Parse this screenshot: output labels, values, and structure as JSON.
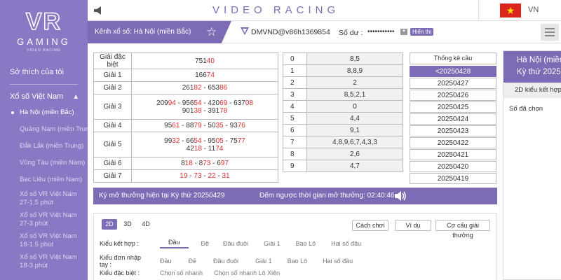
{
  "sidebar": {
    "logo_main": "VR",
    "logo_gaming": "GAMING",
    "logo_sub": "VIDEO RACING",
    "favorites": "Sở thích của tôi",
    "group": "Xổ số Việt Nam",
    "items": [
      {
        "label": "Hà Nội (miền Bắc)"
      },
      {
        "label": "Quảng Nam (miền Trung)"
      },
      {
        "label": "Đắk Lắk (miền Trung)"
      },
      {
        "label": "Vũng Tàu (miền Nam)"
      },
      {
        "label": "Bạc Liêu (miền Nam)"
      },
      {
        "label": "Xổ số VR Việt Nam 27-1.5 phút"
      },
      {
        "label": "Xổ số VR Việt Nam 27-3 phút"
      },
      {
        "label": "Xổ số VR Việt Nam 18-1.5 phút"
      },
      {
        "label": "Xổ số VR Việt Nam 18-3 phút"
      }
    ]
  },
  "header": {
    "title": "VIDEO RACING",
    "lang": "VN",
    "flag_star": "★"
  },
  "account": {
    "channel": "Kênh xổ số: Hà Nội (miền Bắc)",
    "username": "DMVND@v86h1369854",
    "balance_label": "Số dư :",
    "balance_mask": "•••••••••••",
    "show_label": "Hiển thị"
  },
  "results": [
    {
      "name": "Giải đặc biệt",
      "lines": [
        [
          [
            "751",
            ""
          ],
          [
            "40",
            "red"
          ]
        ]
      ]
    },
    {
      "name": "Giải 1",
      "lines": [
        [
          [
            "166",
            ""
          ],
          [
            "74",
            "red"
          ]
        ]
      ]
    },
    {
      "name": "Giải 2",
      "lines": [
        [
          [
            "261",
            ""
          ],
          [
            "82",
            "red"
          ],
          [
            " - 653",
            ""
          ],
          [
            "86",
            "red"
          ]
        ]
      ]
    },
    {
      "name": "Giải 3",
      "lines": [
        [
          [
            "209",
            ""
          ],
          [
            "94",
            "red"
          ],
          [
            " - 956",
            ""
          ],
          [
            "54",
            "red"
          ],
          [
            " - 420",
            ""
          ],
          [
            "69",
            "red"
          ],
          [
            " - 637",
            ""
          ],
          [
            "08",
            "red"
          ]
        ],
        [
          [
            "901",
            ""
          ],
          [
            "38",
            "red"
          ],
          [
            " - 391",
            ""
          ],
          [
            "78",
            "red"
          ]
        ]
      ]
    },
    {
      "name": "Giải 4",
      "lines": [
        [
          [
            "95",
            ""
          ],
          [
            "61",
            "red"
          ],
          [
            " - 88",
            ""
          ],
          [
            "79",
            "red"
          ],
          [
            " - 50",
            ""
          ],
          [
            "35",
            "red"
          ],
          [
            " - 93",
            ""
          ],
          [
            "76",
            "red"
          ]
        ]
      ]
    },
    {
      "name": "Giải 5",
      "lines": [
        [
          [
            "99",
            ""
          ],
          [
            "32",
            "red"
          ],
          [
            " - 66",
            ""
          ],
          [
            "54",
            "red"
          ],
          [
            " - 95",
            ""
          ],
          [
            "05",
            "red"
          ],
          [
            " - 75",
            ""
          ],
          [
            "77",
            "red"
          ]
        ],
        [
          [
            "42",
            ""
          ],
          [
            "18",
            "red"
          ],
          [
            " - 11",
            ""
          ],
          [
            "74",
            "red"
          ]
        ]
      ]
    },
    {
      "name": "Giải 6",
      "lines": [
        [
          [
            "8",
            ""
          ],
          [
            "18",
            "red"
          ],
          [
            " - 8",
            ""
          ],
          [
            "73",
            "red"
          ],
          [
            " - 6",
            ""
          ],
          [
            "97",
            "red"
          ]
        ]
      ]
    },
    {
      "name": "Giải 7",
      "lines": [
        [
          [
            "19",
            "red"
          ],
          [
            " - ",
            ""
          ],
          [
            "73",
            "red"
          ],
          [
            " - ",
            ""
          ],
          [
            "22",
            "red"
          ],
          [
            " - ",
            ""
          ],
          [
            "31",
            "red"
          ]
        ]
      ]
    }
  ],
  "lo": [
    {
      "n": "0",
      "v": "8,5"
    },
    {
      "n": "1",
      "v": "8,8,9"
    },
    {
      "n": "2",
      "v": "2"
    },
    {
      "n": "3",
      "v": "8,5,2,1"
    },
    {
      "n": "4",
      "v": "0"
    },
    {
      "n": "5",
      "v": "4,4"
    },
    {
      "n": "6",
      "v": "9,1"
    },
    {
      "n": "7",
      "v": "4,8,9,6,7,4,3,3"
    },
    {
      "n": "8",
      "v": "2,6"
    },
    {
      "n": "9",
      "v": "4,7"
    }
  ],
  "stats": {
    "header": "Thống kê cầu",
    "items": [
      "<20250428",
      "20250427",
      "20250426",
      "20250425",
      "20250424",
      "20250423",
      "20250422",
      "20250421",
      "20250420",
      "20250419"
    ]
  },
  "rpanel": {
    "head_line1": "Hà Nội (miền",
    "head_line2": "Kỳ thứ 2025",
    "kieu": "2D kiểu kết hợp",
    "chosen": "Số đã chọn"
  },
  "countbar": {
    "ky": "Kỳ mở thưởng hiện tại Kỳ thứ 20250429",
    "countdown": "Đếm ngược thời gian mở thưởng: 02:40:46"
  },
  "bet": {
    "dtabs": [
      "2D",
      "3D",
      "4D"
    ],
    "buttons": [
      "Cách chơi",
      "Ví dụ",
      "Cơ cấu giải thưởng"
    ],
    "rows": [
      {
        "label": "Kiểu kết hợp :",
        "options": [
          "Đầu",
          "Đề",
          "Đầu đuôi",
          "Giải 1",
          "Bao Lô",
          "Hai số đầu"
        ]
      },
      {
        "label": "Kiểu đơn nhập tay :",
        "options": [
          "Đầu",
          "Đề",
          "Đầu đuôi",
          "Giải 1",
          "Bao Lô",
          "Hai số đầu"
        ]
      },
      {
        "label": "Kiểu đặc biệt :",
        "options": [
          "Chọn số nhanh",
          "Chọn số nhanh Lô Xiên"
        ]
      }
    ]
  },
  "colors": {
    "accent": "#7d6bb5",
    "sidebar": "#8b78c4",
    "highlight": "#d9302f"
  }
}
